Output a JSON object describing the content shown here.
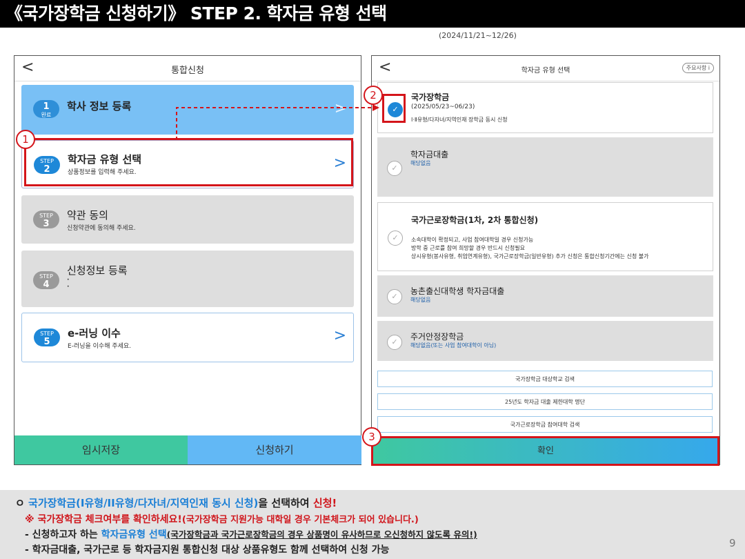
{
  "title": "《국가장학금 신청하기》 STEP 2. 학자금 유형 선택",
  "date_range": "(2024/11/21~12/26)",
  "left_screen": {
    "back": "<",
    "header": "통합신청",
    "steps": [
      {
        "badge_top": "1",
        "badge_bottom": "완료",
        "title": "학사 정보 등록",
        "desc": ""
      },
      {
        "badge_top": "STEP",
        "badge_bottom": "2",
        "title": "학자금 유형 선택",
        "desc": "상품정보를 입력해 주세요."
      },
      {
        "badge_top": "STEP",
        "badge_bottom": "3",
        "title": "약관 동의",
        "desc": "신청약관에 동의해 주세요."
      },
      {
        "badge_top": "STEP",
        "badge_bottom": "4",
        "title": "신청정보 등록",
        "desc": "·\n·"
      },
      {
        "badge_top": "STEP",
        "badge_bottom": "5",
        "title": "e-러닝 이수",
        "desc": "E-러닝을 이수해 주세요."
      }
    ],
    "chevron": ">",
    "temp_save": "임시저장",
    "apply": "신청하기"
  },
  "right_screen": {
    "back": "<",
    "header": "학자금 유형 선택",
    "help_badge": "주요사항 ⅰ",
    "options": [
      {
        "title": "국가장학금",
        "line1": "(2025/05/23~06/23)",
        "line2": "Ⅰ·Ⅱ유형/다자녀/지역인재 장학금 동시 신청",
        "checked": true
      },
      {
        "title": "학자금대출",
        "line1": "해당없음",
        "checked": false
      },
      {
        "title": "국가근로장학금(1차, 2차 통합신청)",
        "line1": "소속대학이 확정되고, 사업 참여대학일 경우 신청가능",
        "line2": "방학 중 근로를 참여 희망할 경우 반드시 신청필요",
        "line3": "상시유형(봉사유형, 취업연계유형), 국가근로장학금(일반유형) 추가 신청은 통합신청기간에는 신청 불가",
        "checked": false
      },
      {
        "title": "농촌출신대학생 학자금대출",
        "line1": "해당없음",
        "checked": false
      },
      {
        "title": "주거안정장학금",
        "line1": "해당없음(또는 사업 참여대학이 아님)",
        "checked": false
      }
    ],
    "links": [
      "국가장학금 대상학교 검색",
      "25년도 학자금 대출 제한대학 명단",
      "국가근로장학금 참여대학 검색"
    ],
    "confirm": "확인",
    "check_mark": "✓"
  },
  "markers": [
    "1",
    "2",
    "3"
  ],
  "footer": {
    "line1": {
      "bullet": "ㅇ ",
      "blue": "국가장학금(I유형/II유형/다자녀/지역인재 동시 신청)",
      "mid": "을 선택하여 ",
      "red": "신청!"
    },
    "line2": {
      "red": "※ 국가장학금 체크여부를 확인하세요!",
      "red_small": "(국가장학금 지원가능 대학일 경우 기본체크가 되어 있습니다.)"
    },
    "line3": {
      "prefix": "- 신청하고자 하는 ",
      "blue": "학자금유형 선택",
      "note": "(국가장학금과 국가근로장학금의 경우 상품명이 유사하므로 오신청하지 않도록 유의!)"
    },
    "line4": {
      "text": "- 학자금대출, 국가근로 등 학자금지원 통합신청 대상 상품유형도 함께 선택하여 신청 가능"
    }
  },
  "page_number": "9",
  "colors": {
    "accent_blue": "#1e88d8",
    "highlight_red": "#d4141a",
    "step_done": "#79c0f5",
    "step_inactive": "#dedede"
  }
}
